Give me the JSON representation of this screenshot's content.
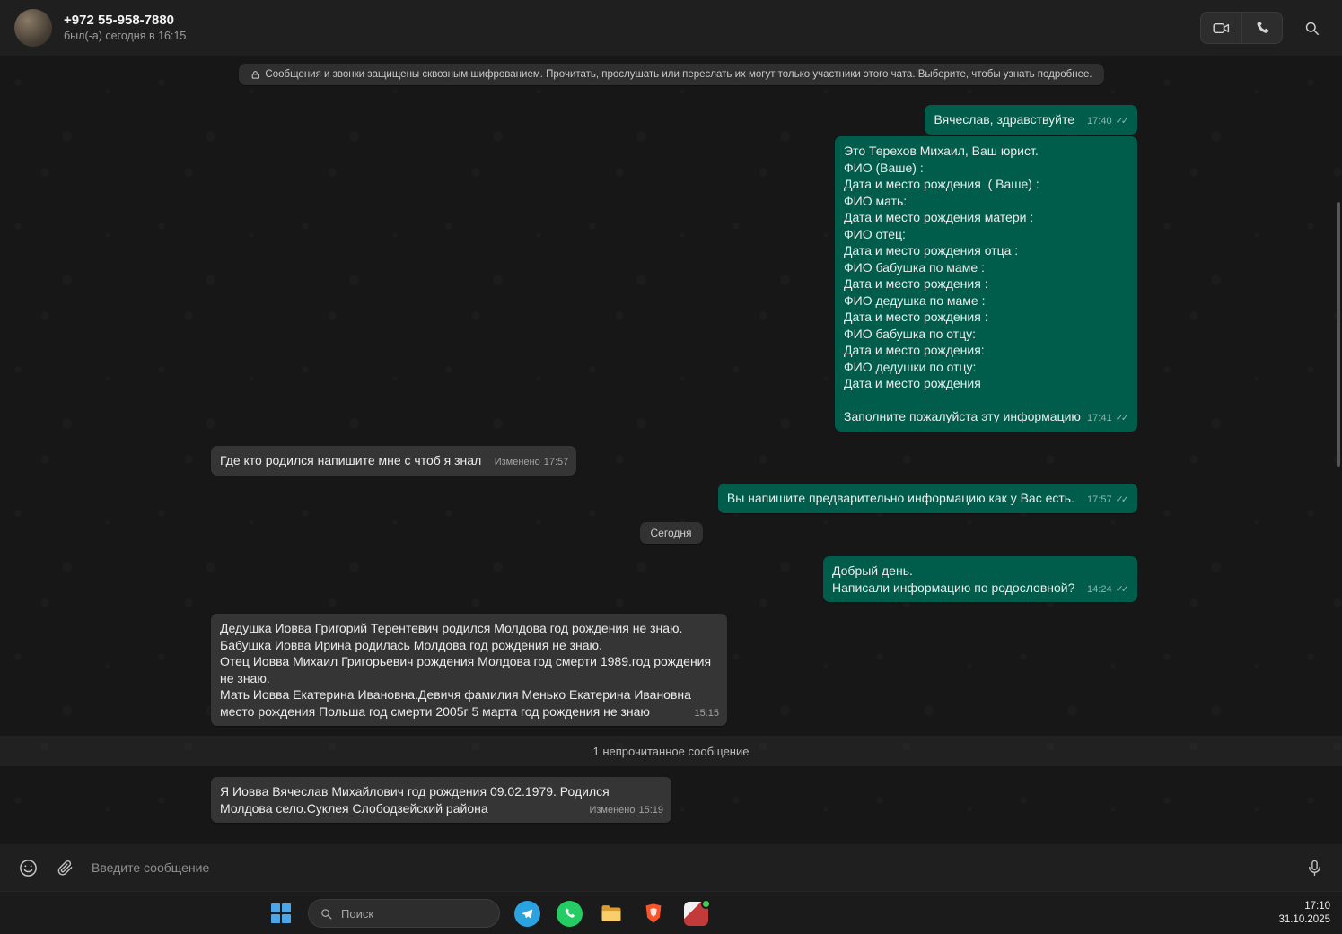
{
  "header": {
    "title": "+972 55-958-7880",
    "subtitle": "был(-а) сегодня в 16:15"
  },
  "chat": {
    "encryption_notice": "Сообщения и звонки защищены сквозным шифрованием. Прочитать, прослушать или переслать их могут только участники этого чата. Выберите, чтобы узнать подробнее.",
    "date_divider": "Сегодня",
    "unread_divider": "1 непрочитанное сообщение",
    "messages": [
      {
        "direction": "out",
        "text": "Вячеслав, здравствуйте",
        "time": "17:40",
        "ticks": "✓✓"
      },
      {
        "direction": "out",
        "text": "Это Терехов Михаил, Ваш юрист.\nФИО (Ваше) :\nДата и место рождения  ( Ваше) :\nФИО мать:\nДата и место рождения матери :\nФИО отец:\nДата и место рождения отца :\nФИО бабушка по маме :\nДата и место рождения :\nФИО дедушка по маме :\nДата и место рождения :\nФИО бабушка по отцу:\nДата и место рождения:\nФИО дедушки по отцу:\nДата и место рождения\n\nЗаполните пожалуйста эту информацию",
        "time": "17:41",
        "ticks": "✓✓"
      },
      {
        "direction": "in",
        "text": "Где кто родился напишите мне с чтоб я знал",
        "edited": "Изменено",
        "time": "17:57"
      },
      {
        "direction": "out",
        "text": "Вы напишите предварительно информацию как у Вас есть.",
        "time": "17:57",
        "ticks": "✓✓"
      },
      {
        "direction": "out",
        "text": "Добрый день.\nНаписали информацию по родословной?",
        "time": "14:24",
        "ticks": "✓✓"
      },
      {
        "direction": "in",
        "text": "Дедушка Иовва Григорий Терентевич родился Молдова год рождения не знаю.\nБабушка Иовва Ирина родилась Молдова год рождения не знаю.\nОтец Иовва Михаил Григорьевич рождения Молдова год смерти 1989.год рождения не знаю.\nМать Иовва Екатерина Ивановна.Девичя фамилия Менько Екатерина Ивановна место рождения Польша год смерти 2005г 5 марта год рождения не знаю",
        "time": "15:15"
      },
      {
        "direction": "in",
        "text": "Я Иовва Вячеслав Михайлович год рождения 09.02.1979. Родился Молдова село.Суклея Слободзейский района",
        "edited": "Изменено",
        "time": "15:19"
      }
    ]
  },
  "composer": {
    "placeholder": "Введите сообщение"
  },
  "taskbar": {
    "search_placeholder": "Поиск",
    "clock_time": "17:10",
    "clock_date": "31.10.2025"
  },
  "colors": {
    "outgoing_bubble": "#005d4b",
    "incoming_bubble": "#353535",
    "header_bg": "#1f1f1f",
    "whatsapp_green": "#24cc63",
    "telegram_blue": "#2aa3e0"
  }
}
